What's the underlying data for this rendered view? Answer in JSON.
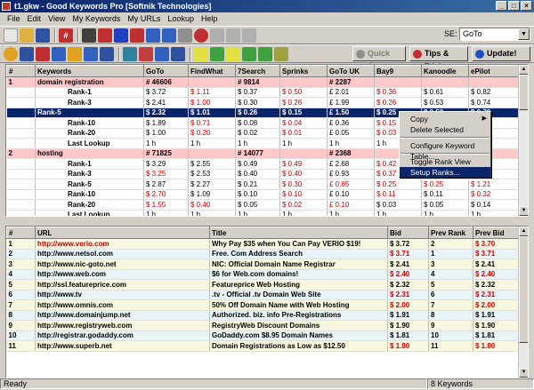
{
  "window": {
    "title": "t1.gkw - Good Keywords Pro [Softnik Technologies]"
  },
  "menu": [
    "File",
    "Edit",
    "View",
    "My Keywords",
    "My URLs",
    "Lookup",
    "Help"
  ],
  "se": {
    "label": "SE:",
    "value": "GoTo"
  },
  "buttons": {
    "quick_start": "Quick Start",
    "tips": "Tips & Tricks",
    "update": "Update!"
  },
  "top_table": {
    "headers": [
      "#",
      "Keywords",
      "GoTo",
      "FindWhat",
      "7Search",
      "Sprinks",
      "GoTo UK",
      "Bay9",
      "Kanoodle",
      "ePilot"
    ],
    "rows": [
      {
        "cells": [
          "1",
          "domain registration",
          "# 46606",
          "",
          "# 9814",
          "",
          "# 2287",
          "",
          "",
          ""
        ],
        "type": "pink",
        "red": []
      },
      {
        "cells": [
          "",
          "Rank-1",
          "$ 3.72",
          "$ 1.11",
          "$ 0.37",
          "$ 0.50",
          "£ 2.01",
          "$ 0.36",
          "$ 0.61",
          "$ 0.82"
        ],
        "type": "ind",
        "red": [
          3,
          5,
          7
        ]
      },
      {
        "cells": [
          "",
          "Rank-3",
          "$ 2.41",
          "$ 1.00",
          "$ 0.30",
          "$ 0.26",
          "£ 1.99",
          "$ 0.26",
          "$ 0.53",
          "$ 0.74"
        ],
        "type": "ind",
        "red": [
          3,
          5,
          7
        ]
      },
      {
        "cells": [
          "",
          "Rank-5",
          "$ 2.32",
          "$ 1.01",
          "$ 0.26",
          "$ 0.15",
          "£ 1.50",
          "$ 0.25",
          "$ 0.52",
          "$ 0.70"
        ],
        "type": "sel",
        "red": []
      },
      {
        "cells": [
          "",
          "Rank-10",
          "$ 1.89",
          "$ 0.71",
          "$ 0.08",
          "$ 0.04",
          "£ 0.36",
          "$ 0.15",
          "$ 0.36",
          "$ 0.00"
        ],
        "type": "ind",
        "red": [
          3,
          5,
          7
        ]
      },
      {
        "cells": [
          "",
          "Rank-20",
          "$ 1.00",
          "$ 0.20",
          "$ 0.02",
          "$ 0.01",
          "£ 0.05",
          "$ 0.03",
          "$ 0.11",
          "$ 0.00"
        ],
        "type": "ind",
        "red": [
          3,
          5,
          7
        ]
      },
      {
        "cells": [
          "",
          "Last Lookup",
          "1 h",
          "1 h",
          "1 h",
          "1 h",
          "1 h",
          "1 h",
          "1 h",
          "1 h"
        ],
        "type": "ind",
        "red": []
      },
      {
        "cells": [
          "2",
          "hosting",
          "# 71825",
          "",
          "# 14077",
          "",
          "# 2368",
          "",
          "",
          ""
        ],
        "type": "pink",
        "red": []
      },
      {
        "cells": [
          "",
          "Rank-1",
          "$ 3.29",
          "$ 2.55",
          "$ 0.49",
          "$ 0.49",
          "£ 2.68",
          "$ 0.42",
          "$ 0.96",
          "$ 0.61"
        ],
        "type": "ind",
        "red": [
          5,
          7
        ]
      },
      {
        "cells": [
          "",
          "Rank-3",
          "$ 3.25",
          "$ 2.53",
          "$ 0.40",
          "$ 0.40",
          "£ 0.93",
          "$ 0.37",
          "$ 0.80",
          "$ 0.48"
        ],
        "type": "ind",
        "red": [
          2,
          5,
          7
        ]
      },
      {
        "cells": [
          "",
          "Rank-5",
          "$ 2.87",
          "$ 2.27",
          "$ 0.21",
          "$ 0.30",
          "£ 0.65",
          "$ 0.25",
          "$ 0.25",
          "$ 1.21"
        ],
        "type": "ind",
        "red": [
          5,
          6,
          7,
          8,
          9
        ]
      },
      {
        "cells": [
          "",
          "Rank-10",
          "$ 2.70",
          "$ 1.09",
          "$ 0.10",
          "$ 0.10",
          "£ 0.10",
          "$ 0.11",
          "$ 0.11",
          "$ 0.32"
        ],
        "type": "ind",
        "red": [
          2,
          5,
          7,
          9
        ]
      },
      {
        "cells": [
          "",
          "Rank-20",
          "$ 1.55",
          "$ 0.40",
          "$ 0.05",
          "$ 0.02",
          "£ 0.10",
          "$ 0.03",
          "$ 0.05",
          "$ 0.14"
        ],
        "type": "ind",
        "red": [
          2,
          3,
          5,
          6
        ]
      },
      {
        "cells": [
          "",
          "Last Lookup",
          "1 h",
          "1 h",
          "1 h",
          "1 h",
          "1 h",
          "1 h",
          "1 h",
          "1 h"
        ],
        "type": "ind",
        "red": []
      }
    ]
  },
  "context_menu": [
    "Copy",
    "Delete Selected",
    "Configure Keyword Table...",
    "Toggle Rank View",
    "Setup Ranks..."
  ],
  "bottom_table": {
    "headers": [
      "#",
      "URL",
      "Title",
      "Bid",
      "Prev Rank",
      "Prev Bid"
    ],
    "rows": [
      {
        "cells": [
          "1",
          "http://www.verio.com",
          "Why Pay $35 when You Can Pay VERIO $19!",
          "$ 3.72",
          "2",
          "$ 3.70"
        ],
        "red": [
          1,
          5
        ]
      },
      {
        "cells": [
          "2",
          "http://www.netsol.com",
          "Free. Com Address Search",
          "$ 3.71",
          "1",
          "$ 3.71"
        ],
        "red": [
          3,
          5
        ]
      },
      {
        "cells": [
          "3",
          "http://www.nic-goto.net",
          "NIC: Official Domain Name Registrar",
          "$ 2.41",
          "3",
          "$ 2.41"
        ],
        "red": []
      },
      {
        "cells": [
          "4",
          "http://www.web.com",
          "$6 for Web.com domains!",
          "$ 2.40",
          "4",
          "$ 2.40"
        ],
        "red": [
          3,
          5
        ]
      },
      {
        "cells": [
          "5",
          "http://ssl.featureprice.com",
          "Featureprice Web Hosting",
          "$ 2.32",
          "5",
          "$ 2.32"
        ],
        "red": []
      },
      {
        "cells": [
          "6",
          "http://www.tv",
          ".tv - Official .tv Domain Web Site",
          "$ 2.31",
          "6",
          "$ 2.31"
        ],
        "red": [
          3,
          5
        ]
      },
      {
        "cells": [
          "7",
          "http://www.omnis.com",
          "50% Off Domain Name with Web Hosting",
          "$ 2.00",
          "7",
          "$ 2.00"
        ],
        "red": [
          3,
          5
        ]
      },
      {
        "cells": [
          "8",
          "http://www.domainjump.net",
          "Authorized. biz. info Pre-Registrations",
          "$ 1.91",
          "8",
          "$ 1.91"
        ],
        "red": []
      },
      {
        "cells": [
          "9",
          "http://www.registryweb.com",
          "RegistryWeb Discount Domains",
          "$ 1.90",
          "9",
          "$ 1.90"
        ],
        "red": []
      },
      {
        "cells": [
          "10",
          "http://registrar.godaddy.com",
          "GoDaddy.com $8.95 Domain Names",
          "$ 1.81",
          "10",
          "$ 1.81"
        ],
        "red": []
      },
      {
        "cells": [
          "11",
          "http://www.superb.net",
          "Domain Registrations as Low as $12.50",
          "$ 1.80",
          "11",
          "$ 1.80"
        ],
        "red": [
          3,
          5
        ]
      }
    ]
  },
  "status": {
    "left": "Ready",
    "right": "8 Keywords"
  }
}
